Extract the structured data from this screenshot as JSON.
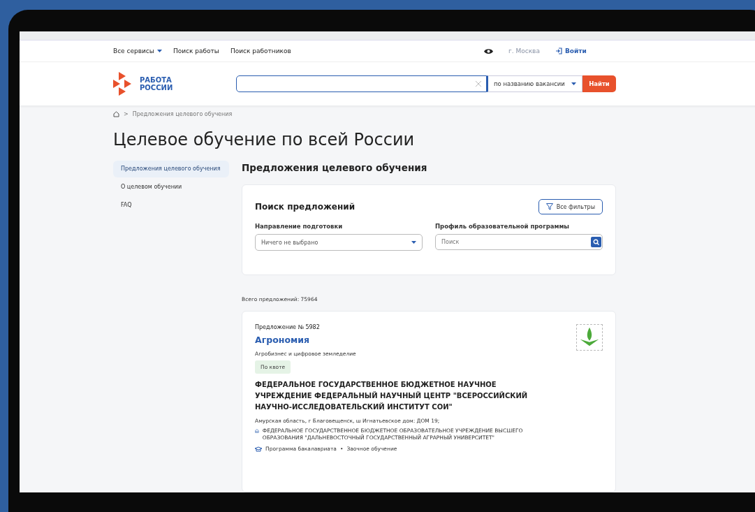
{
  "topnav": {
    "services": "Все сервисы",
    "links": [
      "Поиск работы",
      "Поиск работников"
    ],
    "city": "г. Москва",
    "login": "Войти"
  },
  "header": {
    "logo_line1": "РАБОТА",
    "logo_line2": "РОССИИ",
    "search_mode": "по названию вакансии",
    "search_button": "Найти"
  },
  "breadcrumb_separator": ">",
  "breadcrumbs": [
    "Предложения целевого обучения"
  ],
  "page_title": "Целевое обучение по всей России",
  "sidebar": {
    "items": [
      {
        "label": "Предложения целевого обучения",
        "selected": true
      },
      {
        "label": "О целевом обучении",
        "selected": false
      },
      {
        "label": "FAQ",
        "selected": false
      }
    ]
  },
  "section_title": "Предложения целевого обучения",
  "search_panel": {
    "title": "Поиск предложений",
    "filters_button": "Все фильтры",
    "direction_label": "Направление подготовки",
    "direction_value": "Ничего не выбрано",
    "profile_label": "Профиль образовательной программы",
    "profile_placeholder": "Поиск"
  },
  "total": "Всего предложений: 75964",
  "offers": [
    {
      "number": "Предложение № 5982",
      "title": "Агрономия",
      "profile": "Агробизнес и цифровое земледелие",
      "tag": "По квоте",
      "employer": "ФЕДЕРАЛЬНОЕ ГОСУДАРСТВЕННОЕ БЮДЖЕТНОЕ НАУЧНОЕ УЧРЕЖДЕНИЕ ФЕДЕРАЛЬНЫЙ НАУЧНЫЙ ЦЕНТР \"ВСЕРОССИЙСКИЙ НАУЧНО-ИССЛЕДОВАТЕЛЬСКИЙ ИНСТИТУТ СОИ\"",
      "address": "Амурская область, г Благовещенск, ш Игнатьевское дом: ДОМ 19;",
      "university": "ФЕДЕРАЛЬНОЕ ГОСУДАРСТВЕННОЕ БЮДЖЕТНОЕ ОБРАЗОВАТЕЛЬНОЕ УЧРЕЖДЕНИЕ ВЫСШЕГО ОБРАЗОВАНИЯ \"ДАЛЬНЕВОСТОЧНЫЙ ГОСУДАРСТВЕННЫЙ АГРАРНЫЙ УНИВЕРСИТЕТ\"",
      "program": "Программа бакалавриата",
      "separator": "•",
      "form": "Заочное обучение"
    }
  ]
}
